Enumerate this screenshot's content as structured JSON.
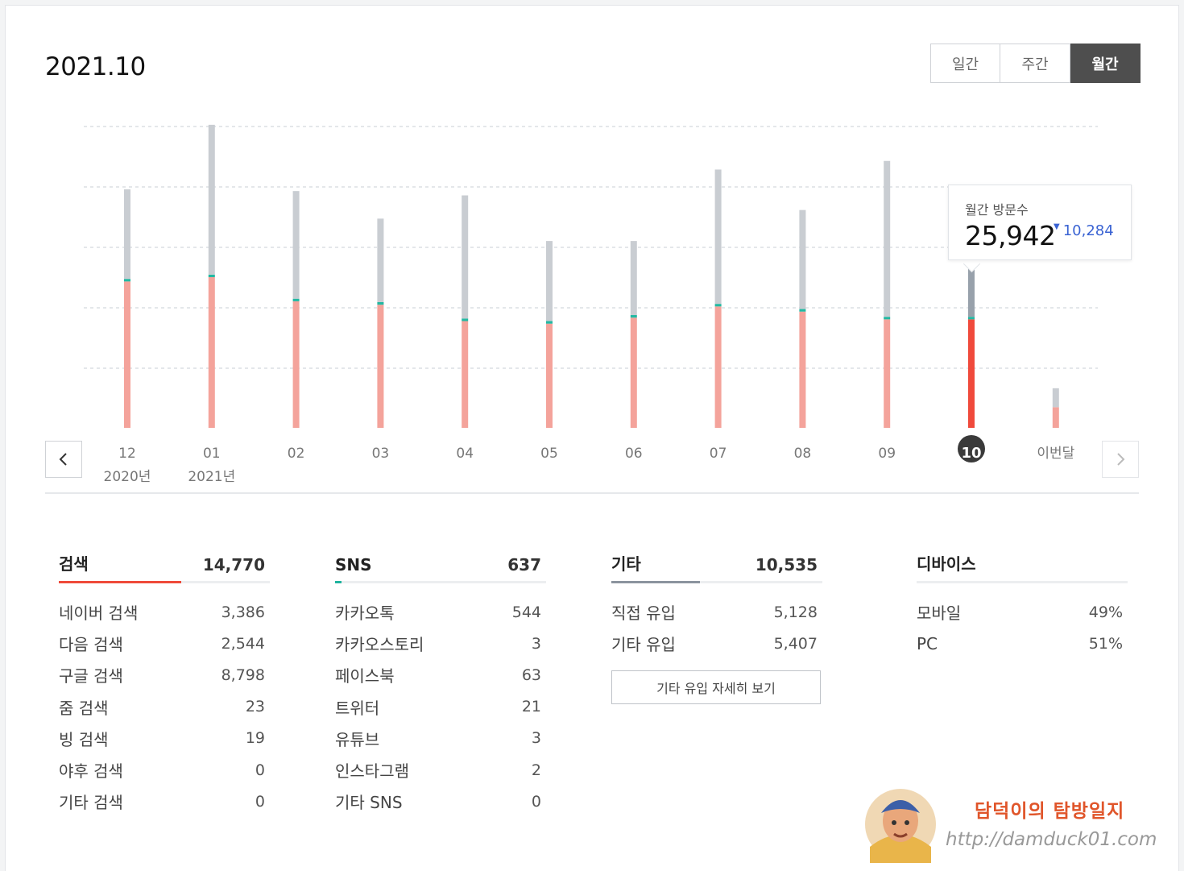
{
  "period": {
    "title": "2021.10"
  },
  "view_toggle": {
    "daily": "일간",
    "weekly": "주간",
    "monthly": "월간",
    "active": "monthly"
  },
  "chart_data": {
    "type": "bar",
    "stacked": true,
    "grid": true,
    "legend": "none",
    "ylim": [
      0,
      35000
    ],
    "categories": [
      "12",
      "01",
      "02",
      "03",
      "04",
      "05",
      "06",
      "07",
      "08",
      "09",
      "10",
      "이번달"
    ],
    "year_labels": [
      "2020년",
      "2021년",
      "",
      "",
      "",
      "",
      "",
      "",
      "",
      "",
      "",
      ""
    ],
    "selected_index": 10,
    "series": [
      {
        "color": "#f4a39b",
        "selected_color": "#f04a3c",
        "values": [
          17000,
          17500,
          14700,
          14300,
          12400,
          12100,
          12800,
          14100,
          13500,
          12600,
          12600,
          2400
        ]
      },
      {
        "color": "#23b8a2",
        "values": [
          300,
          300,
          300,
          300,
          300,
          300,
          300,
          300,
          300,
          300,
          300,
          0
        ]
      },
      {
        "color": "#c9cdd2",
        "selected_color": "#98a1ab",
        "values": [
          10400,
          17400,
          12500,
          9700,
          14300,
          9300,
          8600,
          15600,
          11500,
          18100,
          9100,
          2200
        ]
      }
    ]
  },
  "tooltip": {
    "label": "월간 방문수",
    "value": "25,942",
    "delta": "10,284"
  },
  "breakdown": [
    {
      "title": "검색",
      "total": "14,770",
      "bar_color": "#ef4a3a",
      "share": 0.58,
      "items": [
        {
          "label": "네이버 검색",
          "value": "3,386"
        },
        {
          "label": "다음 검색",
          "value": "2,544"
        },
        {
          "label": "구글 검색",
          "value": "8,798"
        },
        {
          "label": "줌 검색",
          "value": "23"
        },
        {
          "label": "빙 검색",
          "value": "19"
        },
        {
          "label": "야후 검색",
          "value": "0"
        },
        {
          "label": "기타 검색",
          "value": "0"
        }
      ]
    },
    {
      "title": "SNS",
      "total": "637",
      "bar_color": "#1fb39e",
      "share": 0.03,
      "items": [
        {
          "label": "카카오톡",
          "value": "544"
        },
        {
          "label": "카카오스토리",
          "value": "3"
        },
        {
          "label": "페이스북",
          "value": "63"
        },
        {
          "label": "트위터",
          "value": "21"
        },
        {
          "label": "유튜브",
          "value": "3"
        },
        {
          "label": "인스타그램",
          "value": "2"
        },
        {
          "label": "기타 SNS",
          "value": "0"
        }
      ]
    },
    {
      "title": "기타",
      "total": "10,535",
      "bar_color": "#8b949e",
      "share": 0.42,
      "items": [
        {
          "label": "직접 유입",
          "value": "5,128"
        },
        {
          "label": "기타 유입",
          "value": "5,407"
        }
      ],
      "detail_button": "기타 유입 자세히 보기"
    },
    {
      "title": "디바이스",
      "total": "",
      "bar_color": "#eceef0",
      "share": 0,
      "items": [
        {
          "label": "모바일",
          "value": "49%"
        },
        {
          "label": "PC",
          "value": "51%"
        }
      ]
    }
  ],
  "brand": {
    "name": "담덕이의 탐방일지",
    "url": "http://damduck01.com"
  }
}
